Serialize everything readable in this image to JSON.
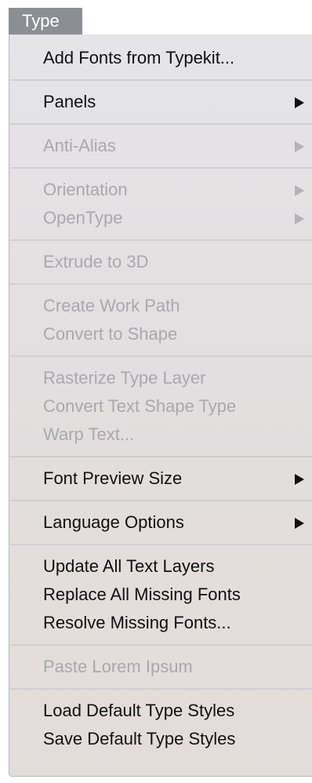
{
  "menu": {
    "title": "Type",
    "items": [
      {
        "label": "Add Fonts from Typekit...",
        "enabled": true,
        "submenu": false
      },
      {
        "label": "Panels",
        "enabled": true,
        "submenu": true
      },
      {
        "label": "Anti-Alias",
        "enabled": false,
        "submenu": true
      },
      {
        "label": "Orientation",
        "enabled": false,
        "submenu": true
      },
      {
        "label": "OpenType",
        "enabled": false,
        "submenu": true
      },
      {
        "label": "Extrude to 3D",
        "enabled": false,
        "submenu": false
      },
      {
        "label": "Create Work Path",
        "enabled": false,
        "submenu": false
      },
      {
        "label": "Convert to Shape",
        "enabled": false,
        "submenu": false
      },
      {
        "label": "Rasterize Type Layer",
        "enabled": false,
        "submenu": false
      },
      {
        "label": "Convert Text Shape Type",
        "enabled": false,
        "submenu": false
      },
      {
        "label": "Warp Text...",
        "enabled": false,
        "submenu": false
      },
      {
        "label": "Font Preview Size",
        "enabled": true,
        "submenu": true
      },
      {
        "label": "Language Options",
        "enabled": true,
        "submenu": true
      },
      {
        "label": "Update All Text Layers",
        "enabled": true,
        "submenu": false
      },
      {
        "label": "Replace All Missing Fonts",
        "enabled": true,
        "submenu": false
      },
      {
        "label": "Resolve Missing Fonts...",
        "enabled": true,
        "submenu": false
      },
      {
        "label": "Paste Lorem Ipsum",
        "enabled": false,
        "submenu": false
      },
      {
        "label": "Load Default Type Styles",
        "enabled": true,
        "submenu": false
      },
      {
        "label": "Save Default Type Styles",
        "enabled": true,
        "submenu": false
      }
    ]
  },
  "colors": {
    "enabled_text": "#101010",
    "disabled_text": "#a9a8ac",
    "title_background": "#8d8e93",
    "title_text": "#ffffff",
    "separator": "#d0cfd1"
  },
  "icons": {
    "submenu_indicator": "submenu-arrow-icon"
  }
}
